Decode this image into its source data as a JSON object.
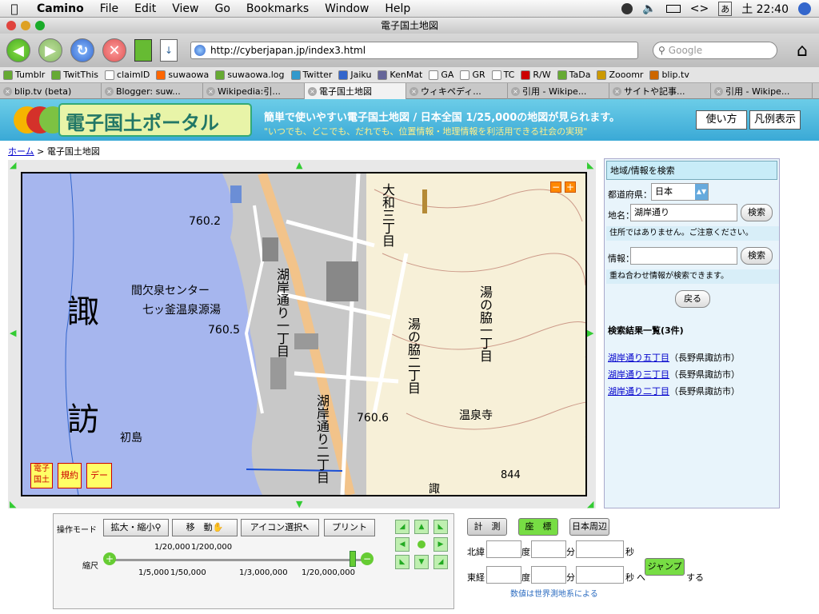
{
  "menubar": {
    "app": "Camino",
    "items": [
      "File",
      "Edit",
      "View",
      "Go",
      "Bookmarks",
      "Window",
      "Help"
    ],
    "ime": "あ",
    "clock": "土 22:40"
  },
  "window": {
    "title": "電子国土地図"
  },
  "toolbar": {
    "url": "http://cyberjapan.jp/index3.html",
    "search_placeholder": "Google"
  },
  "bookmarks": [
    {
      "label": "Tumblr",
      "icon": "leaf-icon",
      "color": "#6a3"
    },
    {
      "label": "TwitThis",
      "icon": "leaf-icon",
      "color": "#6a3"
    },
    {
      "label": "claimID",
      "icon": "claimid-icon",
      "color": "#fff"
    },
    {
      "label": "suwaowa",
      "icon": "blogger-icon",
      "color": "#f60"
    },
    {
      "label": "suwaowa.log",
      "icon": "leaf-icon",
      "color": "#6a3"
    },
    {
      "label": "Twitter",
      "icon": "twitter-icon",
      "color": "#39c"
    },
    {
      "label": "Jaiku",
      "icon": "jaiku-icon",
      "color": "#36c"
    },
    {
      "label": "KenMat",
      "icon": "pen-icon",
      "color": "#669"
    },
    {
      "label": "GA",
      "icon": "google-icon",
      "color": "#fff"
    },
    {
      "label": "GR",
      "icon": "google-icon",
      "color": "#fff"
    },
    {
      "label": "TC",
      "icon": "tc-icon",
      "color": "#fff"
    },
    {
      "label": "R/W",
      "icon": "rw-icon",
      "color": "#c00"
    },
    {
      "label": "TaDa",
      "icon": "leaf-icon",
      "color": "#6a3"
    },
    {
      "label": "Zooomr",
      "icon": "zooomr-icon",
      "color": "#c90"
    },
    {
      "label": "blip.tv",
      "icon": "blip-icon",
      "color": "#c60"
    }
  ],
  "tabs": [
    {
      "label": "blip.tv (beta)",
      "active": false
    },
    {
      "label": "Blogger: suw...",
      "active": false
    },
    {
      "label": "Wikipedia:引...",
      "active": false
    },
    {
      "label": "電子国土地図",
      "active": true
    },
    {
      "label": "ウィキペディ...",
      "active": false
    },
    {
      "label": "引用 - Wikipe...",
      "active": false
    },
    {
      "label": "サイトや記事...",
      "active": false
    },
    {
      "label": "引用 - Wikipe...",
      "active": false
    }
  ],
  "banner": {
    "logo_text": "電子国土ポータル",
    "headline": "簡単で使いやすい電子国土地図 / 日本全国 1/25,000の地図が見られます。",
    "tagline": "\"いつでも、どこでも、だれでも、位置情報・地理情報を利活用できる社会の実現\"",
    "btn_howto": "使い方",
    "btn_legend": "凡例表示"
  },
  "breadcrumb": {
    "home": "ホーム",
    "sep": " > ",
    "current": "電子国土地図"
  },
  "map": {
    "labels": {
      "lake1": "諏",
      "lake2": "訪",
      "kanketsusen": "間欠泉センター",
      "onsen": "七ッ釜温泉源湯",
      "elev1": "760.2",
      "elev2": "760.5",
      "elev3": "760.6",
      "elev4": "844",
      "hatsushima": "初島",
      "kogan": "湖岸通り一丁目",
      "kogan2": "湖岸通り二丁目",
      "yunowaki": "湯の脇一丁目",
      "yunowaki2": "湯の脇二丁目",
      "yunowaki3": "湯の脇",
      "onsenji": "温泉寺",
      "dai": "大和三丁目",
      "suwa_bottom": "諏"
    },
    "stamps": [
      "電子国土",
      "規約",
      "データ"
    ]
  },
  "panel": {
    "header": "地域/情報を検索",
    "pref_label": "都道府県：",
    "pref_value": "日本",
    "place_label": "地名：",
    "place_value": "湖岸通り",
    "search_btn": "検索",
    "note1": "住所ではありません。ご注意ください。",
    "info_label": "情報：",
    "info_value": "",
    "search_btn2": "検索",
    "note2": "重ね合わせ情報が検索できます。",
    "back_btn": "戻る",
    "results_header": "検索結果一覧(3件)",
    "results": [
      {
        "link": "湖岸通り五丁目",
        "pref": "（長野県諏訪市）"
      },
      {
        "link": "湖岸通り三丁目",
        "pref": "（長野県諏訪市）"
      },
      {
        "link": "湖岸通り二丁目",
        "pref": "（長野県諏訪市）"
      }
    ]
  },
  "controls": {
    "mode_label": "操作モード",
    "zoom_btn": "拡大・縮小",
    "move_btn": "移　動",
    "icon_btn": "アイコン選択",
    "print_btn": "プリント",
    "scale_label": "縮尺",
    "scale_top": [
      "1/20,000",
      "1/200,000"
    ],
    "scale_bottom": [
      "1/5,000",
      "1/50,000",
      "1/3,000,000",
      "1/20,000,000"
    ],
    "scale_level": 1.0
  },
  "coords": {
    "measure_btn": "計　測",
    "coord_btn": "座　標",
    "japan_btn": "日本周辺",
    "lat_label": "北緯",
    "lon_label": "東経",
    "deg": "度",
    "min": "分",
    "sec": "秒",
    "to": "へ",
    "jump_btn": "ジャンプ",
    "suru": "する",
    "note": "数値は世界測地系による"
  }
}
